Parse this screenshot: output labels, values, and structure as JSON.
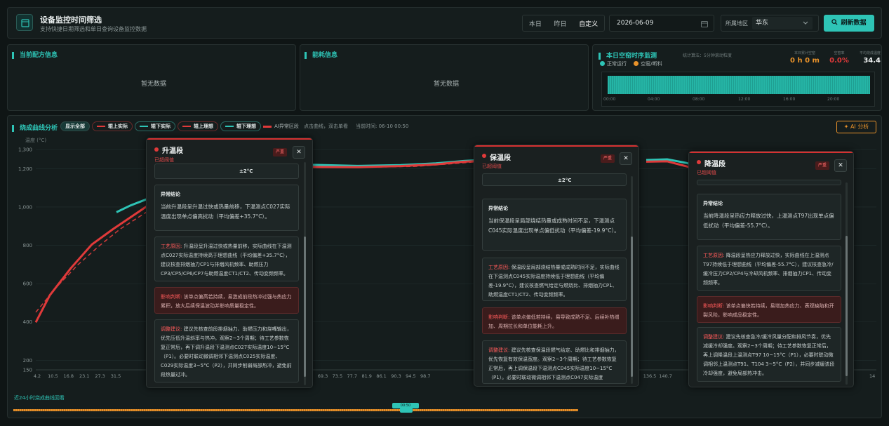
{
  "header": {
    "title": "设备监控时间筛选",
    "subtitle": "支持快捷日期筛选和单日查询设备监控数据",
    "days": [
      "本日",
      "昨日",
      "自定义"
    ],
    "date": "2026-06-09",
    "region_label": "所属地区",
    "region_value": "华东",
    "refresh_label": "刷新数据"
  },
  "panels": {
    "recipe_title": "当前配方信息",
    "energy_title": "能耗信息",
    "empty_text": "暂无数据"
  },
  "idle": {
    "title": "本日空窑时序监测",
    "algo": "统计算法：5分钟滚动粒度",
    "legend_run": "正常运行",
    "legend_idle": "空窑/断料",
    "stat1_label": "本日累计空窑",
    "stat1_value": "0 h 0 m",
    "stat2_label": "空窑率",
    "stat2_value": "0.0%",
    "stat3_label": "平均烧成温度",
    "stat3_value": "34.4",
    "ticks": [
      "00:00",
      "04:00",
      "08:00",
      "12:00",
      "16:00",
      "20:00"
    ]
  },
  "firing": {
    "title": "烧成曲线分析",
    "btn_all": "显示全部",
    "btn_up_actual": "辊上实际",
    "btn_down_actual": "辊下实际",
    "btn_up_ideal": "辊上理想",
    "btn_down_ideal": "辊下理想",
    "ai_zone": "AI异常区段",
    "hint": "点击曲线，双击单看",
    "time_label": "当前时间: 06-10 00:50",
    "ai_button": "AI 分析",
    "timeline_label": "近24小时烧成曲线回看",
    "timeline_time": "00:50"
  },
  "chart_data": {
    "type": "line",
    "ylabel": "温度 (°C)",
    "ylim": [
      150,
      1300
    ],
    "yticks": [
      150,
      200,
      400,
      600,
      800,
      1000,
      1200,
      1300
    ],
    "x_ticks_left": [
      "4.2",
      "10.5",
      "16.8",
      "23.1",
      "27.3",
      "31.5"
    ],
    "x_ticks_mid": [
      "69.3",
      "73.5",
      "77.7",
      "81.9",
      "86.1",
      "90.3",
      "94.5",
      "98.7"
    ],
    "x_ticks_right": [
      "136.5",
      "140.7"
    ],
    "x_tick_end": "14"
  },
  "popups": [
    {
      "title": "升温段",
      "status": "已超阈值",
      "badge": "严重",
      "tolerance": "±2°C",
      "conclusion_title": "异常结论",
      "conclusion": "当前升温段呈升温过快或热量前移，下温测点C027实际温度出现单点偏高扰动（平均偏差+35.7°C）。",
      "process_tag": "工艺原因:",
      "process": "升温段呈升温过快或热量前移，实际曲线在下温测点C027实际温度持续高于理想曲线（平均偏差+35.7°C），建议核查排烟抽力CP1与排烟风机频率、助燃压力CP3/CP5/CP6/CP7与助燃温度CT1/CT2、传动变频频率。",
      "impact_tag": "影响判断:",
      "impact": "该单点偏高若持续，易造成前段热冲过强与热应力累积，放大后续保温波动并影响质量稳定性。",
      "adjust_tag": "调整建议:",
      "adjust": "建议先核查前段排烟抽力、助燃压力和烧嘴输出，优先压低升温斜率与热冲。观察2~3个周期；待工艺参数恢复正常后，再下调升温段下温测点C027实际温度10~15°C（P1）。必要时联动微调相邻下温测点C025实际温度、C029实际温度3~5°C（P2），并同步削弱局部热冲，避免前段热量过冲。"
    },
    {
      "title": "保温段",
      "status": "已超阈值",
      "badge": "严重",
      "tolerance": "±2°C",
      "conclusion_title": "异常结论",
      "conclusion": "当前保温段呈局部烧结热量或成熟时间不足，下温测点C045实际温度出现单点偏低扰动（平均偏差-19.9°C）。",
      "process_tag": "工艺原因:",
      "process": "保温段呈局部烧结热量或成熟时间不足，实际曲线在下温测点C045实际温度持续低于理想曲线（平均偏差-19.9°C），建议核查燃气给定与燃烧比、排烟抽力CP1、助燃温度CT1/CT2、传动变频频率。",
      "impact_tag": "影响判断:",
      "impact": "该单点偏低若持续，易导致成熟不足、后续补热增加、周期拉长和单位能耗上升。",
      "adjust_tag": "调整建议:",
      "adjust": "建议先核查保温段燃气给定、助燃比和排烟抽力，优先恢复有效保温宽度。观察2~3个周期；待工艺参数恢复正常后，再上调保温段下温测点C045实际温度10~15°C（P1）。必要时联动微调相邻下温测点C047实际温度"
    },
    {
      "title": "降温段",
      "status": "已超阈值",
      "badge": "严重",
      "conclusion_title": "异常结论",
      "conclusion": "当前降温段呈热应力释放过快，上温测点T97出现单点偏低扰动（平均偏差-55.7°C）。",
      "process_tag": "工艺原因:",
      "process": "降温段呈热应力释放过快，实际曲线在上温测点T97持续低于理想曲线（平均偏差-55.7°C），建议核查急冷/缓冷压力CP2/CP4与冷却风机频率、排烟抽力CP1、传动变频频率。",
      "impact_tag": "影响判断:",
      "impact": "该单点偏快若持续，易增加热应力、表观缺陷和开裂风险，影响成品稳定性。",
      "adjust_tag": "调整建议:",
      "adjust": "建议先核查急冷/缓冷风量分配和排风节奏，优先减缓冷却强度。观察2~3个周期；待工艺参数恢复正常后，再上调降温段上温测点T97 10~15°C（P1），必要时联动微调相邻上温测点T91、T104 3~5°C（P2），并同步减缓该段冷却强度，避免局部热冲击。"
    }
  ],
  "colors": {
    "accent": "#2ec4b6",
    "danger": "#e03a3a",
    "warn": "#e8922a"
  }
}
